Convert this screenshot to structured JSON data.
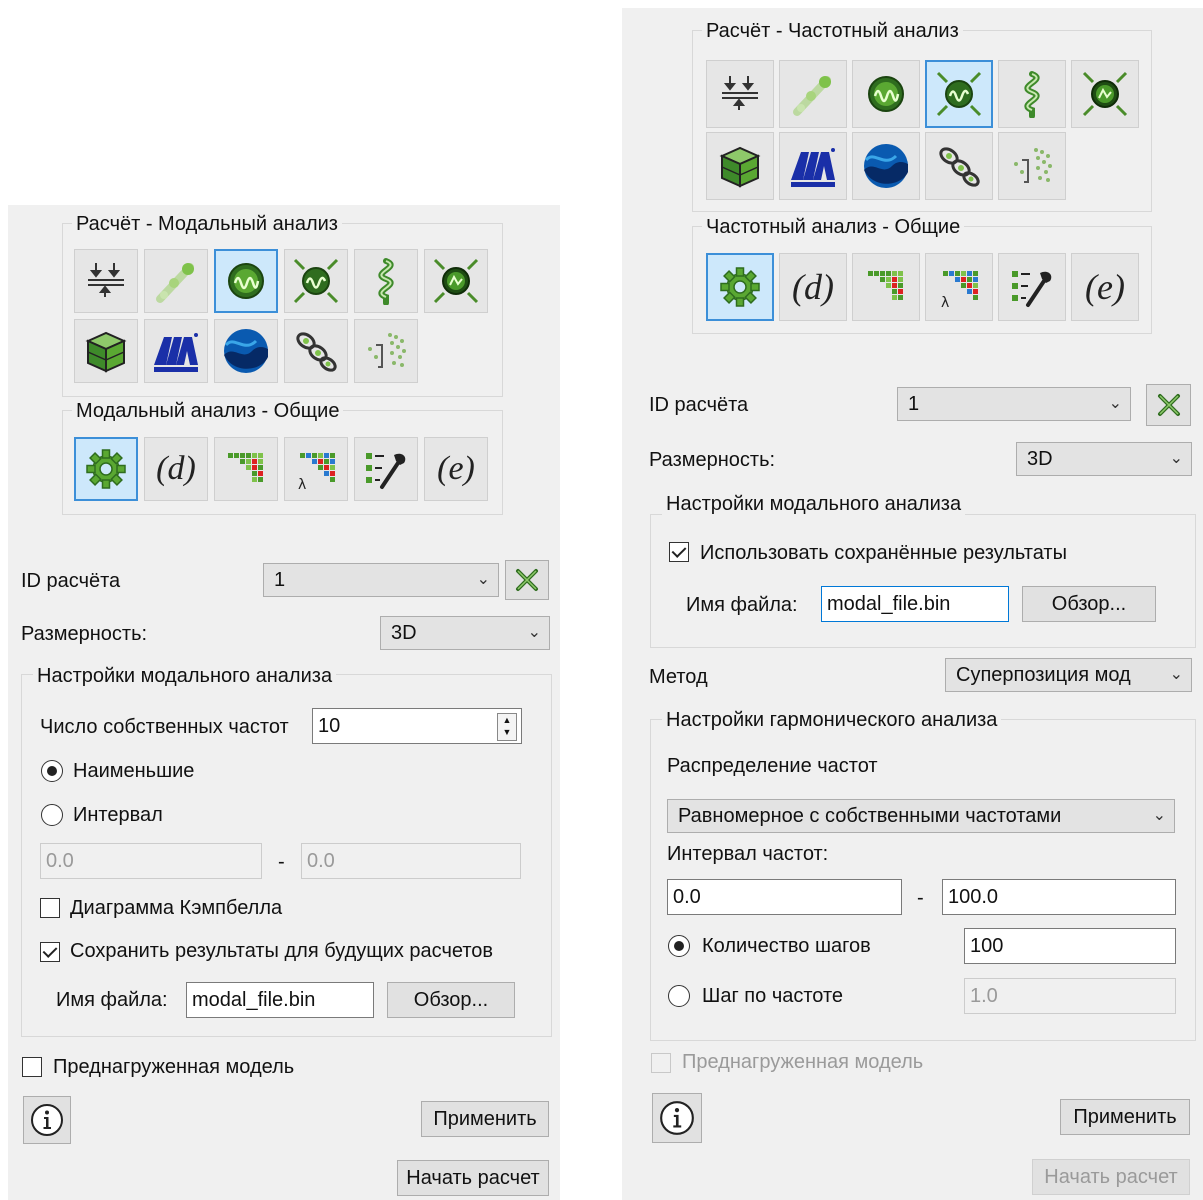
{
  "colors": {
    "panel_bg": "#f0f0f0",
    "active_tool_bg": "#cde8fb",
    "active_tool_border": "#3c8fd8",
    "focus_border": "#0078d7",
    "disabled_text": "#9a9a9a"
  },
  "tool_icons": {
    "row1": [
      "supports-arrows-icon",
      "beam-elements-icon",
      "modal-wave-icon",
      "harmonic-wave-arrows-icon",
      "spring-coil-icon",
      "transient-arrows-icon"
    ],
    "row2": [
      "cube-icon",
      "automechanica-logo-icon",
      "wave-sphere-icon",
      "chain-links-icon",
      "dots-scatter-icon"
    ],
    "common": [
      "gear-icon",
      "d-icon",
      "matrix-icon",
      "lambda-matrix-icon",
      "settings-tools-icon",
      "e-icon"
    ]
  },
  "left": {
    "calc_group_title": "Расчёт - Модальный анализ",
    "common_group_title": "Модальный анализ - Общие",
    "common_d": "(d)",
    "common_e": "(e)",
    "calc_id_label": "ID расчёта",
    "calc_id_value": "1",
    "dimension_label": "Размерность:",
    "dimension_value": "3D",
    "settings_title": "Настройки модального анализа",
    "eigen_label": "Число собственных частот",
    "eigen_value": "10",
    "radio_smallest": "Наименьшие",
    "radio_interval": "Интервал",
    "interval_from": "0.0",
    "interval_sep": "-",
    "interval_to": "0.0",
    "campbell_label": "Диаграмма Кэмпбелла",
    "save_results_label": "Сохранить результаты для будущих расчетов",
    "file_label": "Имя файла:",
    "file_value": "modal_file.bin",
    "browse": "Обзор...",
    "preloaded_label": "Преднагруженная модель",
    "apply": "Применить",
    "start": "Начать расчет"
  },
  "right": {
    "calc_group_title": "Расчёт - Частотный анализ",
    "common_group_title": "Частотный анализ - Общие",
    "common_d": "(d)",
    "common_e": "(e)",
    "calc_id_label": "ID расчёта",
    "calc_id_value": "1",
    "dimension_label": "Размерность:",
    "dimension_value": "3D",
    "modal_settings_title": "Настройки модального анализа",
    "use_saved_label": "Использовать сохранённые результаты",
    "file_label": "Имя файла:",
    "file_value": "modal_file.bin",
    "browse": "Обзор...",
    "method_label": "Метод",
    "method_value": "Суперпозиция мод",
    "harmonic_title": "Настройки гармонического анализа",
    "distribution_label": "Распределение частот",
    "distribution_value": "Равномерное с собственными частотами",
    "freq_interval_label": "Интервал частот:",
    "freq_from": "0.0",
    "freq_sep": "-",
    "freq_to": "100.0",
    "steps_label": "Количество шагов",
    "steps_value": "100",
    "freq_step_label": "Шаг по частоте",
    "freq_step_value": "1.0",
    "preloaded_label": "Преднагруженная модель",
    "apply": "Применить",
    "start": "Начать расчет"
  }
}
